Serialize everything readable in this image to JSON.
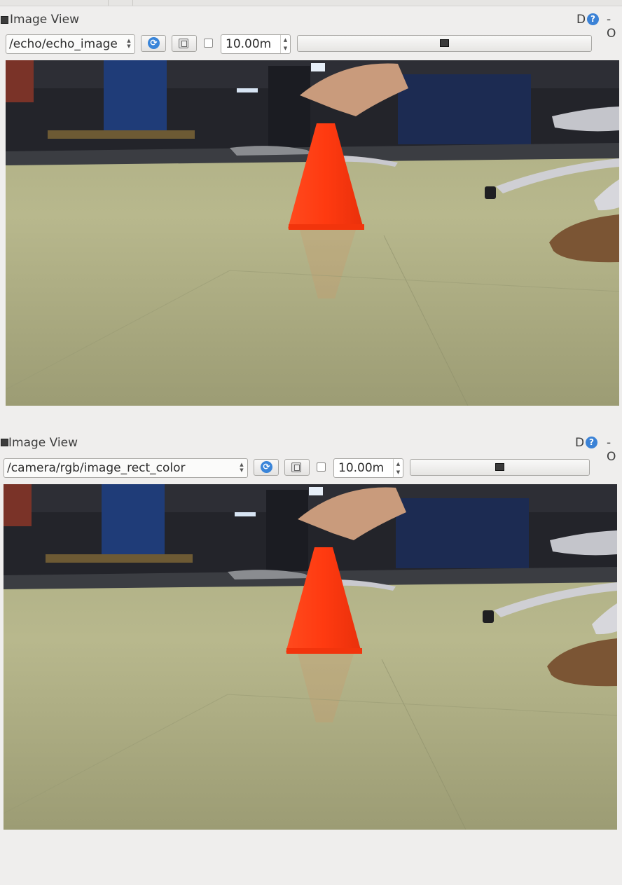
{
  "panels": [
    {
      "title": "Image View",
      "title_right_suffix": "- O",
      "help_glyph": "?",
      "d_glyph": "D",
      "topic": "/echo/echo_image",
      "refresh_glyph": "⟳",
      "checkbox_checked": false,
      "duration": "10.00m",
      "slider_level": 0.5
    },
    {
      "title": "Image View",
      "title_right_suffix": "- O",
      "help_glyph": "?",
      "d_glyph": "D",
      "topic": "/camera/rgb/image_rect_color",
      "refresh_glyph": "⟳",
      "checkbox_checked": false,
      "duration": "10.00m",
      "slider_level": 0.5
    }
  ],
  "colors": {
    "cone": "#ff3a12",
    "floor": "#b7b78a",
    "background_dark": "#22232a",
    "accent_blue": "#3a85d9"
  },
  "icons": {
    "window": "window-icon",
    "help": "help-icon",
    "refresh": "refresh-icon",
    "save": "save-icon",
    "slider": "slider-handle-icon"
  }
}
